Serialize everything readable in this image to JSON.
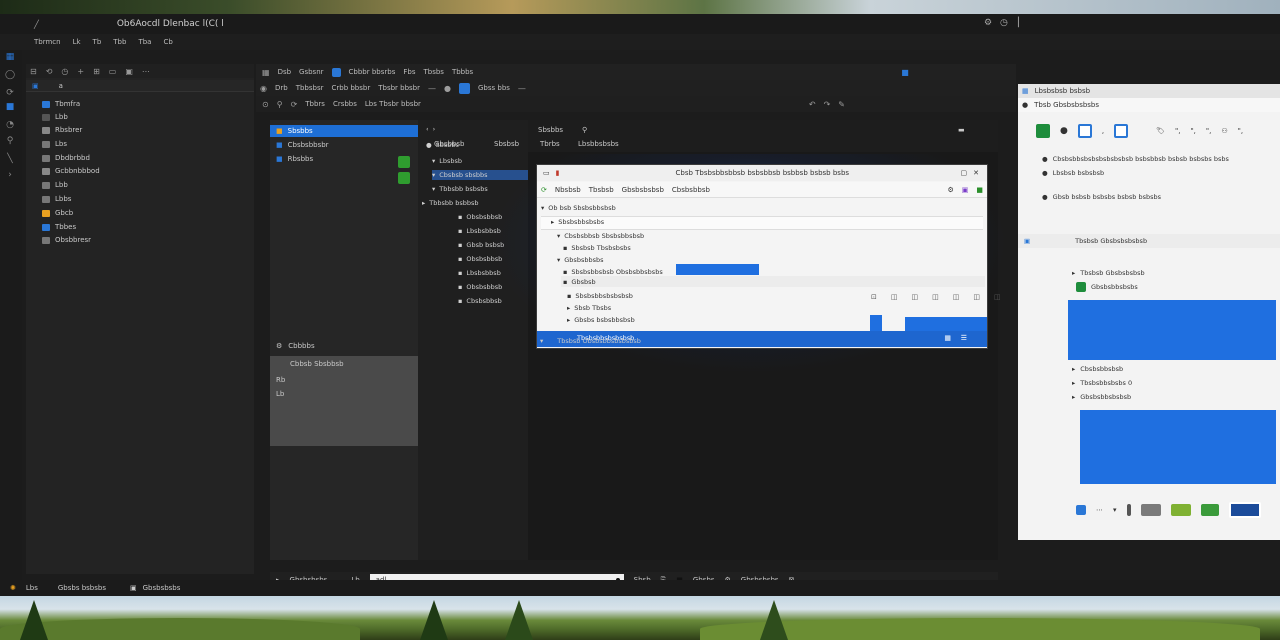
{
  "window": {
    "title": "Ob6Aocdl Dlenbac l(C( l"
  },
  "menubar": {
    "items": [
      "Tbrmcn",
      "Lk",
      "Tb",
      "Tbb",
      "Tba",
      "Cb"
    ]
  },
  "left_panel": {
    "search_text": "a",
    "items": [
      {
        "label": "Tbmfra",
        "color": "#2a77d6"
      },
      {
        "label": "Lbb",
        "color": "#555"
      },
      {
        "label": "Rbsbrer",
        "color": "#888"
      },
      {
        "label": "Lbs",
        "color": "#777"
      },
      {
        "label": "Dbdbrbbd",
        "color": "#777"
      },
      {
        "label": "Gcbbnbbbod",
        "color": "#888"
      },
      {
        "label": "Lbb",
        "color": "#777"
      },
      {
        "label": "Lbbs",
        "color": "#777"
      },
      {
        "label": "Gbcb",
        "color": "#e8a020"
      },
      {
        "label": "Tbbes",
        "color": "#2a77d6"
      },
      {
        "label": "Obsbbresr",
        "color": "#777"
      }
    ]
  },
  "toolbar1": [
    "Dsb",
    "Gsbsnr",
    "Cbbbr bbsrbs",
    "Fbs",
    "Tbsbs",
    "Tbbbs"
  ],
  "toolbar2": [
    "Drb",
    "Tbbsbsr",
    "Crbb bbsbr",
    "Tbsbr bbsbr",
    "Gbss bbs"
  ],
  "toolbar3": [
    "Tbbrs",
    "Crsbbs",
    "Lbs Tbsbr bbsbr"
  ],
  "explorer": {
    "items": [
      "Sbsbbs",
      "Cbsbsbbsbr",
      "Rbsbbs"
    ],
    "footer_title": "Cbbbbs",
    "footer_item": "Cbbsb Sbsbbsb",
    "footer_lines": [
      "Rb",
      "Lb"
    ]
  },
  "editor_tabs": [
    "Sbsbbs",
    "Gbsbbsb",
    "Sbsbsb",
    "Tbrbs",
    "Lbsbbsbsbs"
  ],
  "tree": {
    "items": [
      "Lbsbsb",
      "Cbsbsb sbsbbs",
      "Tbbsbb bsbsbs",
      "Tbbsbb bsbbsb",
      "Obsbsbbsb",
      "Lbsbsbbsb",
      "Gbsb bsbsb",
      "Obsbsbbsb",
      "Lbsbsbbsb",
      "Obsbsbbsb",
      "Cbsbsbbsb",
      "Obsbsbbsb"
    ]
  },
  "dialog": {
    "title": "Cbsb Tbsbsbbsbbsb bsbsbbsb bsbbsb bsbsb bsbs",
    "toolbar": [
      "Nbsbsb",
      "Tbsbsb",
      "Gbsbsbsbsb",
      "Cbsbsbbsb"
    ],
    "lines": [
      "Ob bsb Sbsbsbbsbsb",
      "Sbsbsbbsbsbs",
      "Cbsbsbbsb Sbsbsbbsbsb",
      "Sbsbsb Tbsbsbsbs",
      "Gbsbsbbsbs",
      "Sbsbsbbsbsb Obsbsbbsbsbs",
      "Gbsbsb",
      "Sbsbsbbsbsbsbsb",
      "Sbsb Tbsbs",
      "Gbsbs bsbsbbsbsb",
      "Tbsbsbbsbsbsbsb"
    ],
    "footer": "Tbsbsb Obsbsbbsbsbsbsb"
  },
  "right_panel": {
    "title": "Lbsbsbsb bsbsb",
    "subtitle": "Tbsb Gbsbsbsbsbs",
    "rows": [
      "Cbsbsbbsbsbsbsbsbsbsb bsbsbbsb bsbsb bsbsbs bsbs",
      "Lbsbsb bsbsbsb",
      "Gbsb bsbsb bsbsbs bsbsb bsbsbs",
      "Tbsbsb Gbsbsbsbsbsb",
      "Tbsbsb Gbsbsbsbsb",
      "Gbsbsbbsbsbs",
      "Cbsbsbbsbsb",
      "Tbsbsbbsbsbs 0",
      "Gbsbsbbsbsbsb"
    ]
  },
  "bottom_bar": {
    "left_label": "Gbsbsbsbs",
    "input_prefix": "Lb",
    "input_value": "adl",
    "items": [
      "Sbsb",
      "Gbsbs",
      "Gbsbsbsbs"
    ]
  },
  "statusbar": {
    "items": [
      "Lbs",
      "Gbsbs bsbsbs",
      "Gbsbsbsbs"
    ]
  },
  "colors": {
    "accent": "#1e6fd6",
    "green": "#2f9d2f",
    "bg": "#1c1c1c"
  }
}
